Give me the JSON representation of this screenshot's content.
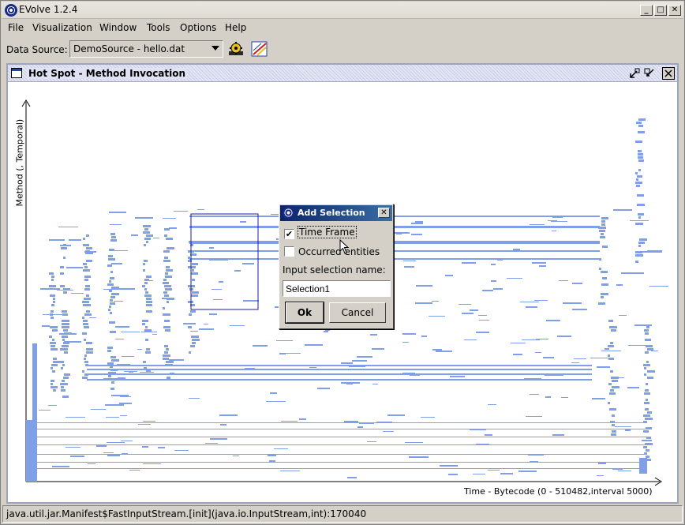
{
  "window": {
    "title": "EVolve 1.2.4",
    "minimize": "_",
    "maximize": "□",
    "close": "✕"
  },
  "menu": [
    "File",
    "Visualization",
    "Window",
    "Tools",
    "Options",
    "Help"
  ],
  "toolbar": {
    "data_source_label": "Data Source:",
    "data_source_value": "DemoSource - hello.dat"
  },
  "internal_frame": {
    "title": "Hot Spot - Method Invocation",
    "y_axis_label": "Method (, Temporal)",
    "x_axis_label": "Time - Bytecode (0 - 510482,interval 5000)"
  },
  "dialog": {
    "title": "Add Selection",
    "time_frame_label": "Time Frame",
    "time_frame_checked": true,
    "occurred_label": "Occurred entities",
    "occurred_checked": false,
    "input_label": "Input selection name:",
    "input_value": "Selection1",
    "ok_label": "Ok",
    "cancel_label": "Cancel"
  },
  "status_bar": {
    "text": "java.util.jar.Manifest$FastInputStream.[init](java.io.InputStream,int):170040"
  },
  "colors": {
    "plot_mark": "#7f9fe8",
    "selection_box": "#1a1ab0",
    "title_bar": "#0a246a"
  }
}
